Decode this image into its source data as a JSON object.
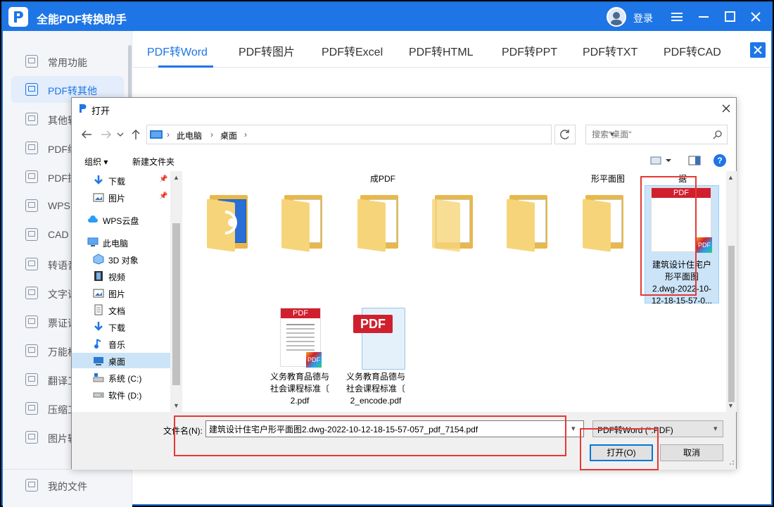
{
  "app": {
    "title": "全能PDF转换助手",
    "login_label": "登录"
  },
  "sidebar": {
    "items": [
      {
        "label": "常用功能"
      },
      {
        "label": "PDF转其他"
      },
      {
        "label": "其他转"
      },
      {
        "label": "PDF编"
      },
      {
        "label": "PDF操"
      },
      {
        "label": "WPS"
      },
      {
        "label": "CAD"
      },
      {
        "label": "转语音"
      },
      {
        "label": "文字识"
      },
      {
        "label": "票证识"
      },
      {
        "label": "万能格"
      },
      {
        "label": "翻译工"
      },
      {
        "label": "压缩工"
      },
      {
        "label": "图片转"
      }
    ],
    "footer_label": "我的文件"
  },
  "tabs": [
    {
      "label": "PDF转Word"
    },
    {
      "label": "PDF转图片"
    },
    {
      "label": "PDF转Excel"
    },
    {
      "label": "PDF转HTML"
    },
    {
      "label": "PDF转PPT"
    },
    {
      "label": "PDF转TXT"
    },
    {
      "label": "PDF转CAD"
    }
  ],
  "dialog": {
    "title": "打开",
    "breadcrumb": [
      "此电脑",
      "桌面"
    ],
    "search_placeholder": "搜索\"桌面\"",
    "organize_label": "组织 ▾",
    "new_folder_label": "新建文件夹",
    "help_label": "?",
    "nav_tree": [
      {
        "label": "下载",
        "pinned": true
      },
      {
        "label": "图片",
        "pinned": true
      },
      {
        "label": "WPS云盘"
      },
      {
        "label": "此电脑"
      },
      {
        "label": "3D 对象"
      },
      {
        "label": "视频"
      },
      {
        "label": "图片"
      },
      {
        "label": "文档"
      },
      {
        "label": "下载"
      },
      {
        "label": "音乐"
      },
      {
        "label": "桌面",
        "selected": true
      },
      {
        "label": "系统 (C:)"
      },
      {
        "label": "软件 (D:)"
      }
    ],
    "top_labels": [
      "成PDF",
      "形平面图",
      "据"
    ],
    "files_row2": [
      {
        "name_lines": [
          "义务教育品德与",
          "社会课程标准〔",
          "2.pdf"
        ],
        "badge": "PDF"
      },
      {
        "name_lines": [
          "义务教育品德与",
          "社会课程标准〔",
          "2_encode.pdf"
        ],
        "badge": "PDF"
      }
    ],
    "selected_file": {
      "name_lines": [
        "建筑设计住宅户",
        "形平面图",
        "2.dwg-2022-10-",
        "12-18-15-57-0..."
      ],
      "badge": "PDF"
    },
    "filename_label": "文件名(N):",
    "filename_value": "建筑设计住宅户形平面图2.dwg-2022-10-12-18-15-57-057_pdf_7154.pdf",
    "filter_value": "PDF转Word (*.PDF)",
    "open_label": "打开(O)",
    "cancel_label": "取消"
  },
  "colors": {
    "brand": "#1e76e6",
    "annotation": "#e53935",
    "pdf_red": "#d0202e"
  }
}
